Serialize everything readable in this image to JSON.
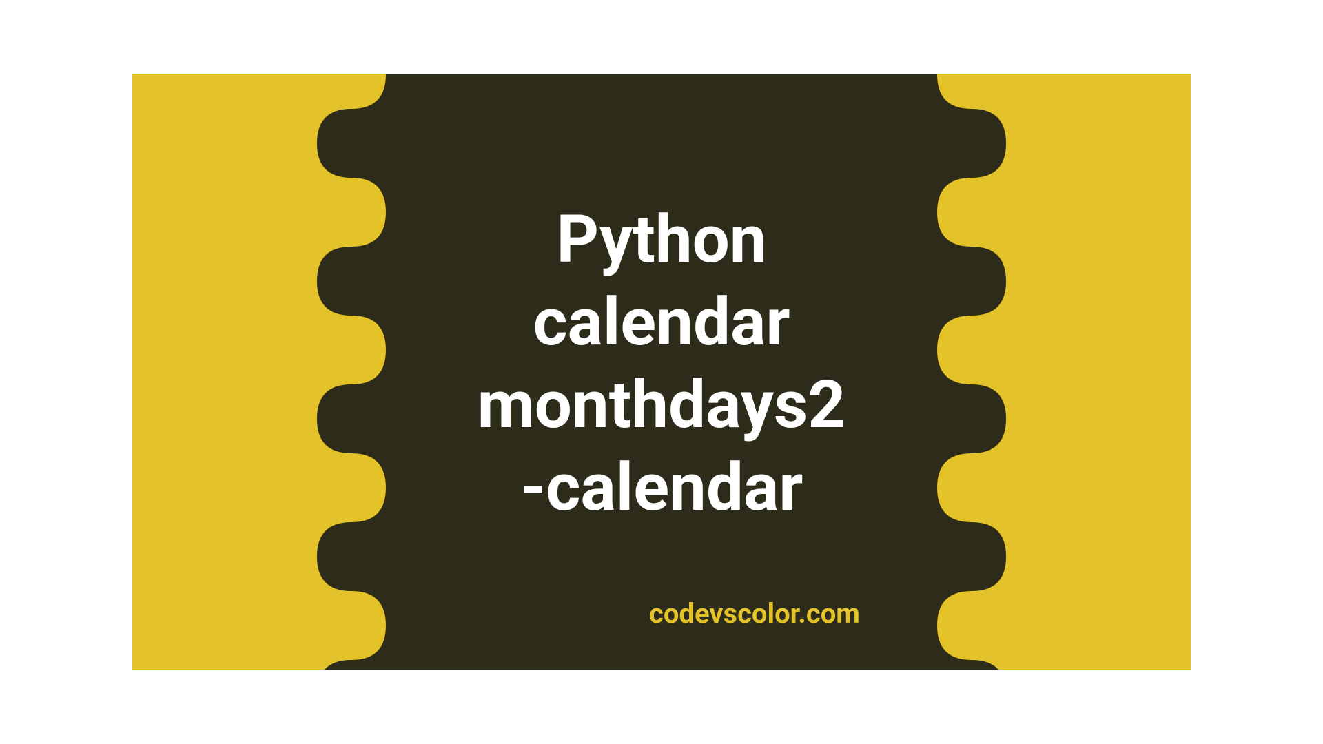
{
  "banner": {
    "title_line1": "Python",
    "title_line2": "calendar",
    "title_line3": "monthdays2",
    "title_line4": "-calendar",
    "watermark": "codevscolor.com",
    "colors": {
      "background": "#e3c22a",
      "blob": "#2d2b1a",
      "title_text": "#ffffff",
      "watermark_text": "#e3c22a"
    }
  }
}
